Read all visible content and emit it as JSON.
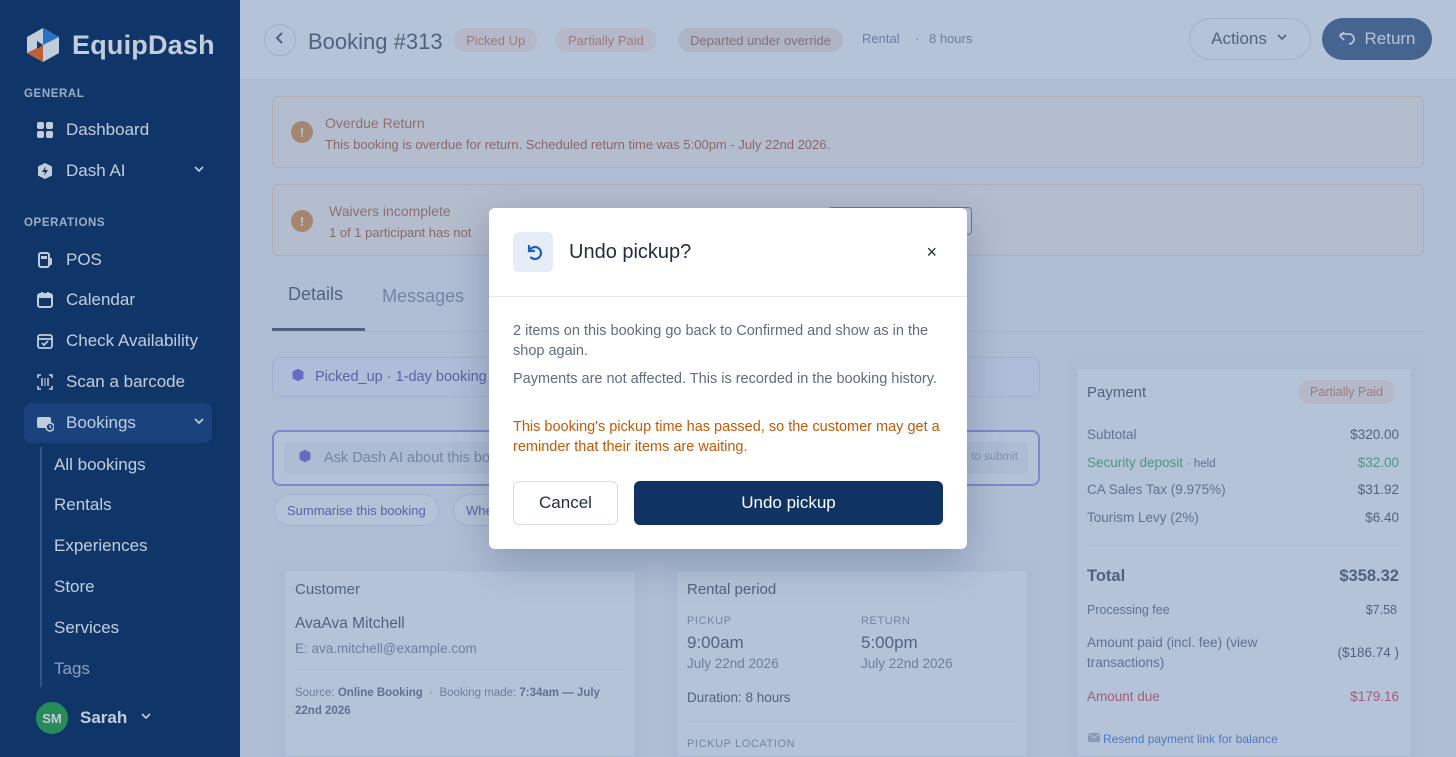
{
  "app": {
    "name": "EquipDash"
  },
  "colors": {
    "sidebar": "#0f3363",
    "primary": "#0f3363",
    "warning": "#c25a08",
    "danger": "#d3222a",
    "success": "#1e9e4a",
    "ai_accent": "#8f7ee0"
  },
  "sidebar": {
    "general_label": "GENERAL",
    "operations_label": "OPERATIONS",
    "general_items": [
      {
        "label": "Dashboard",
        "icon": "grid-icon"
      },
      {
        "label": "Dash AI",
        "icon": "ai-shield-icon"
      }
    ],
    "operation_items": [
      {
        "label": "POS",
        "icon": "pos-icon"
      },
      {
        "label": "Calendar",
        "icon": "calendar-icon"
      },
      {
        "label": "Check Availability",
        "icon": "calendar-check-icon"
      },
      {
        "label": "Scan a barcode",
        "icon": "barcode-icon"
      },
      {
        "label": "Bookings",
        "icon": "bookings-icon"
      }
    ],
    "booking_subitems": [
      "All bookings",
      "Rentals",
      "Experiences",
      "Store",
      "Services",
      "Tags"
    ],
    "user": {
      "initials": "SM",
      "name": "Sarah"
    }
  },
  "header": {
    "title": "Booking #313",
    "status_pills": [
      "Picked Up",
      "Partially Paid",
      "Departed under override"
    ],
    "type": "Rental",
    "separator": "·",
    "duration": "8 hours",
    "actions_label": "Actions",
    "return_label": "Return"
  },
  "alerts": [
    {
      "title": "Overdue Return",
      "body": "This booking is overdue for return. Scheduled return time was 5:00pm - July 22nd 2026."
    },
    {
      "title": "Waivers incomplete",
      "body": "1 of 1 participant has not"
    }
  ],
  "tabs": [
    "Details",
    "Messages"
  ],
  "ai": {
    "strip_text": "Picked_up · 1-day booking",
    "input_placeholder": "Ask Dash AI about this bo",
    "submit_hint": "to submit",
    "chips": [
      "Summarise this booking",
      "Whe"
    ]
  },
  "customer": {
    "title": "Customer",
    "name": "AvaAva Mitchell",
    "email_prefix": "E:",
    "email": "ava.mitchell@example.com",
    "source_label": "Source:",
    "source": "Online Booking",
    "made_label": "Booking made:",
    "made_line1": "7:34am — July",
    "made_line2": "22nd 2026"
  },
  "rental_period": {
    "title": "Rental period",
    "pickup_label": "PICKUP",
    "pickup_time": "9:00am",
    "pickup_date": "July 22nd 2026",
    "return_label": "RETURN",
    "return_time": "5:00pm",
    "return_date": "July 22nd 2026",
    "duration": "Duration: 8 hours",
    "location_label": "PICKUP LOCATION"
  },
  "payment": {
    "title": "Payment",
    "status": "Partially Paid",
    "rows": [
      {
        "label": "Subtotal",
        "value": "$320.00"
      },
      {
        "label": "Security deposit",
        "note": "· held",
        "value": "$32.00"
      },
      {
        "label": "CA Sales Tax (9.975%)",
        "value": "$31.92"
      },
      {
        "label": "Tourism Levy (2%)",
        "value": "$6.40"
      }
    ],
    "total_label": "Total",
    "total_value": "$358.32",
    "fee_label": "Processing fee",
    "fee_value": "$7.58",
    "paid_label_1": "Amount paid (incl. fee) (view",
    "paid_label_2": "transactions)",
    "paid_value": "($186.74  )",
    "due_label": "Amount due",
    "due_value": "$179.16",
    "resend_label": "Resend payment link for balance"
  },
  "modal": {
    "title": "Undo pickup?",
    "close": "×",
    "paragraph1": "2 items on this booking go back to Confirmed and show as in the shop again.",
    "paragraph2": "Payments are not affected. This is recorded in the booking history.",
    "warning": "This booking's pickup time has passed, so the customer may get a reminder that their items are waiting.",
    "cancel_label": "Cancel",
    "confirm_label": "Undo pickup"
  }
}
